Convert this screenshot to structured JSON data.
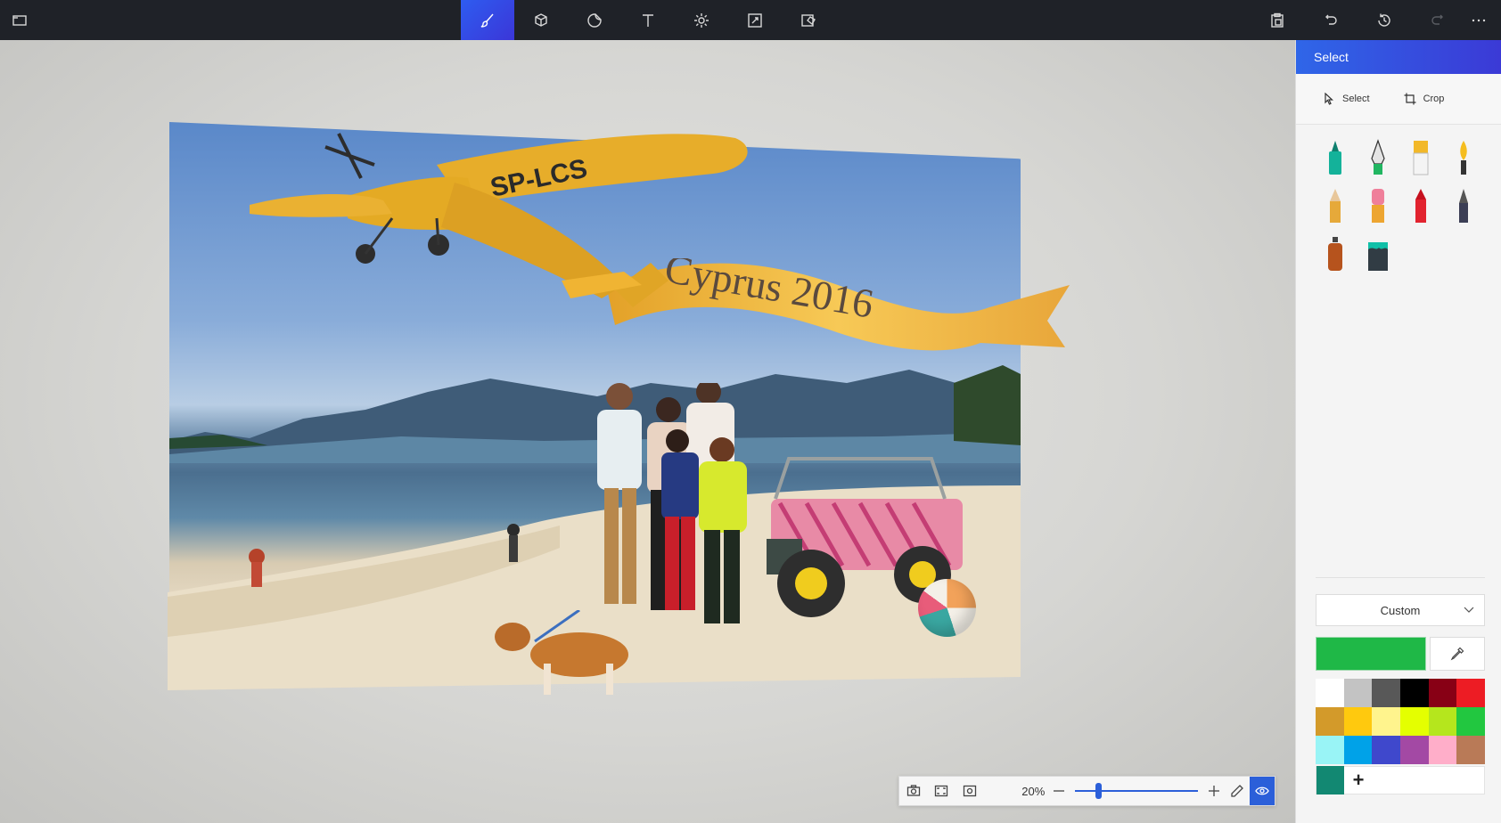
{
  "toolbar": {
    "menu_icon": "folder-icon",
    "tools": [
      {
        "name": "brushes",
        "icon": "brush-icon",
        "active": true
      },
      {
        "name": "3d-shapes",
        "icon": "cube-icon"
      },
      {
        "name": "stickers",
        "icon": "sticker-icon"
      },
      {
        "name": "text",
        "icon": "text-icon"
      },
      {
        "name": "effects",
        "icon": "sun-icon"
      },
      {
        "name": "canvas",
        "icon": "resize-icon"
      },
      {
        "name": "3d-library",
        "icon": "library-icon"
      }
    ],
    "right": [
      "paste-icon",
      "undo-icon",
      "history-icon",
      "redo-icon",
      "more-icon"
    ]
  },
  "canvas": {
    "banner_text": "Cyprus 2016",
    "plane_registration": "SP-LCS"
  },
  "viewbar": {
    "zoom": "20%",
    "zoom_level": 0.16
  },
  "panel": {
    "title": "Select",
    "select_label": "Select",
    "crop_label": "Crop",
    "dropdown_value": "Custom",
    "current_color": "#1fb847",
    "palette": [
      "#ffffff",
      "#c3c3c3",
      "#585858",
      "#000000",
      "#880015",
      "#ed1c24",
      "#d39a2a",
      "#ffc90e",
      "#fff48d",
      "#e4ff00",
      "#b5e61d",
      "#22c740",
      "#99f4f6",
      "#00a2e8",
      "#3f48cc",
      "#a349a4",
      "#ffaec9",
      "#b97a57"
    ],
    "custom_color": "#128872"
  }
}
